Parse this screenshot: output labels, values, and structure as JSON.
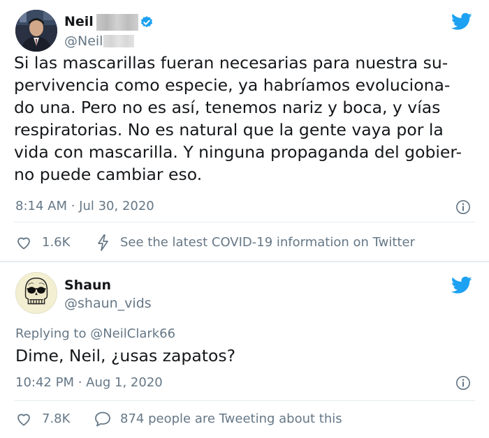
{
  "tweets": [
    {
      "author": {
        "name": "Neil",
        "handle": "@Neil",
        "verified": true
      },
      "text_lines": [
        "Si las mascarillas fueran necesarias para nuestra su-",
        "pervivencia como especie, ya habríamos evoluciona-",
        "do una. Pero no es así, tenemos nariz y boca, y vías",
        "respiratorias. No es natural que la gente vaya por la",
        "vida con mascarilla. Y ninguna propaganda del gobier-",
        "no puede cambiar eso."
      ],
      "timestamp": "8:14 AM · Jul 30, 2020",
      "likes": "1.6K",
      "notice": "See the latest COVID-19 information on Twitter"
    },
    {
      "author": {
        "name": "Shaun",
        "handle": "@shaun_vids"
      },
      "replying_label": "Replying to",
      "replying_to": "@NeilClark66",
      "text": "Dime, Neil, ¿usas zapatos?",
      "timestamp": "10:42 PM · Aug 1, 2020",
      "likes": "7.8K",
      "replies_text": "874 people are Tweeting about this"
    }
  ],
  "icons": {
    "brand": "twitter-bird-icon",
    "verified": "verified-badge-icon",
    "info": "info-icon",
    "like": "heart-icon",
    "notice": "lightning-icon",
    "reply": "speech-bubble-icon"
  },
  "colors": {
    "twitter_blue": "#1DA1F2",
    "secondary_text": "#657786",
    "primary_text": "#14171A",
    "divider": "#E6ECF0"
  }
}
